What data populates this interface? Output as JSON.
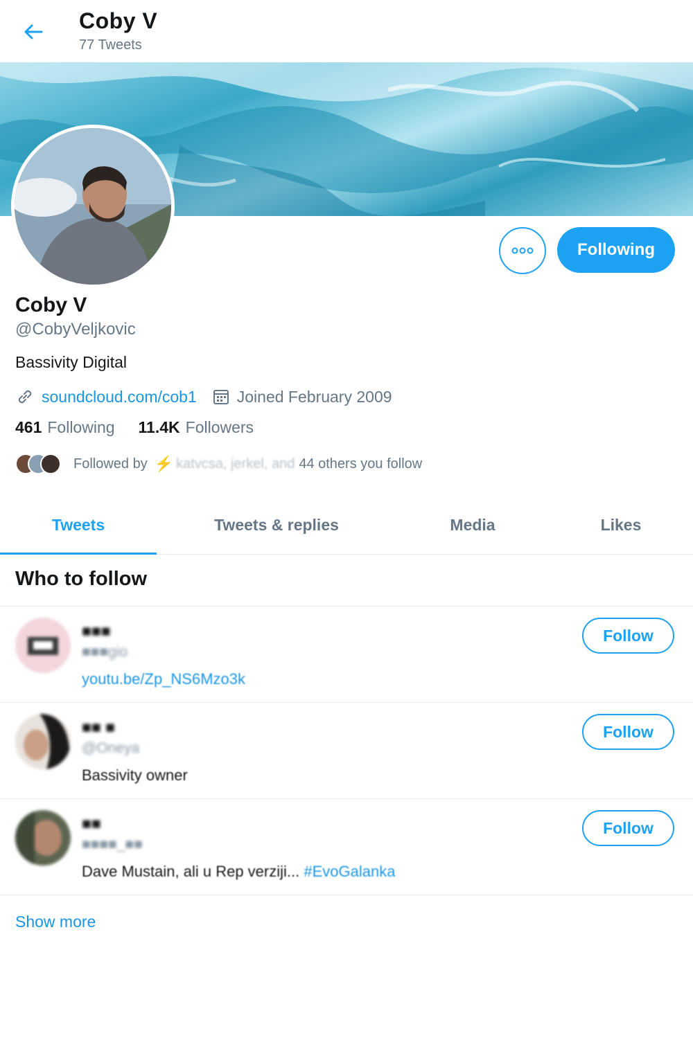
{
  "header": {
    "title": "Coby V",
    "subtitle": "77 Tweets",
    "back_icon": "arrow-left-icon"
  },
  "profile": {
    "name": "Coby V",
    "handle": "@CobyVeljkovic",
    "bio": "Bassivity Digital",
    "link": "soundcloud.com/cob1",
    "joined": "Joined February 2009",
    "following_count": "461",
    "following_label": "Following",
    "followers_count": "11.4K",
    "followers_label": "Followers",
    "followed_by_prefix": "Followed by",
    "followed_by_names": "katvcsa, jerkel, and",
    "followed_by_suffix": "44 others you follow"
  },
  "actions": {
    "more_icon": "more-dots-icon",
    "following_label": "Following"
  },
  "tabs": [
    {
      "label": "Tweets",
      "active": true
    },
    {
      "label": "Tweets & replies",
      "active": false
    },
    {
      "label": "Media",
      "active": false
    },
    {
      "label": "Likes",
      "active": false
    }
  ],
  "who_to_follow": {
    "heading": "Who to follow",
    "suggestions": [
      {
        "name": "■■■",
        "handle": "■■■gio",
        "bio": "youtu.be/Zp_NS6Mzo3k",
        "button": "Follow"
      },
      {
        "name": "■■ ■",
        "handle": "@Oneya",
        "bio": "Bassivity owner",
        "button": "Follow"
      },
      {
        "name": "■■",
        "handle": "■■■■_■■",
        "bio": "Dave Mustain, ali u Rep verziji...",
        "hashtag": "#EvoGalanka",
        "button": "Follow"
      }
    ],
    "show_more": "Show more"
  },
  "colors": {
    "accent": "#1da1f2",
    "link": "#1b95e0",
    "secondary_text": "#657786",
    "divider": "#e6ecf0"
  }
}
